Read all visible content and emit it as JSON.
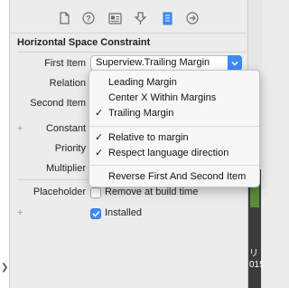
{
  "toolbar": {
    "icons": [
      "file-icon",
      "help-icon",
      "identity-icon",
      "attributes-icon",
      "size-icon",
      "connections-icon"
    ],
    "selected_icon": "size-icon"
  },
  "inspector": {
    "section_title": "Horizontal Space Constraint",
    "labels": {
      "first_item": "First Item",
      "relation": "Relation",
      "second_item": "Second Item",
      "constant": "Constant",
      "priority": "Priority",
      "multiplier": "Multiplier",
      "placeholder": "Placeholder"
    },
    "first_item_value": "Superview.Trailing Margin",
    "placeholder_checkbox_label": "Remove at build time",
    "installed_checkbox_label": "Installed",
    "plus_symbol": "+"
  },
  "menu": {
    "items": [
      {
        "label": "Leading Margin",
        "checked": false
      },
      {
        "label": "Center X Within Margins",
        "checked": false
      },
      {
        "label": "Trailing Margin",
        "checked": true
      }
    ],
    "options": [
      {
        "label": "Relative to margin",
        "checked": true
      },
      {
        "label": "Respect language direction",
        "checked": true
      }
    ],
    "action": {
      "label": "Reverse First And Second Item"
    },
    "checkmark": "✓"
  },
  "right_panel": {
    "text_line1": "リ",
    "text_line2": "015"
  },
  "colors": {
    "accent": "#3b8cf7",
    "background": "#ececec"
  }
}
